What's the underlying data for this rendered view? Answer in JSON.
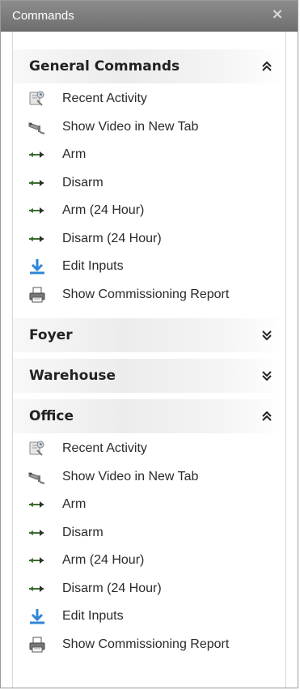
{
  "window": {
    "title": "Commands",
    "close_glyph": "×"
  },
  "sections": [
    {
      "title": "General Commands",
      "expanded": true,
      "items": [
        {
          "label": "Recent Activity",
          "icon": "recent-activity-icon"
        },
        {
          "label": "Show Video in New Tab",
          "icon": "camera-icon"
        },
        {
          "label": "Arm",
          "icon": "arm-arrows-icon"
        },
        {
          "label": "Disarm",
          "icon": "disarm-arrows-icon"
        },
        {
          "label": "Arm (24 Hour)",
          "icon": "arm-arrows-icon"
        },
        {
          "label": "Disarm (24 Hour)",
          "icon": "disarm-arrows-icon"
        },
        {
          "label": "Edit Inputs",
          "icon": "edit-inputs-icon"
        },
        {
          "label": "Show Commissioning Report",
          "icon": "printer-icon"
        }
      ]
    },
    {
      "title": "Foyer",
      "expanded": false,
      "items": []
    },
    {
      "title": "Warehouse",
      "expanded": false,
      "items": []
    },
    {
      "title": "Office",
      "expanded": true,
      "items": [
        {
          "label": "Recent Activity",
          "icon": "recent-activity-icon"
        },
        {
          "label": "Show Video in New Tab",
          "icon": "camera-icon"
        },
        {
          "label": "Arm",
          "icon": "arm-arrows-icon"
        },
        {
          "label": "Disarm",
          "icon": "disarm-arrows-icon"
        },
        {
          "label": "Arm (24 Hour)",
          "icon": "arm-arrows-icon"
        },
        {
          "label": "Disarm (24 Hour)",
          "icon": "disarm-arrows-icon"
        },
        {
          "label": "Edit Inputs",
          "icon": "edit-inputs-icon"
        },
        {
          "label": "Show Commissioning Report",
          "icon": "printer-icon"
        }
      ]
    }
  ],
  "colors": {
    "titlebar": "#7d7d7d",
    "arm_arrow": "#3b6e2e",
    "edit_inputs": "#2f86d6"
  }
}
